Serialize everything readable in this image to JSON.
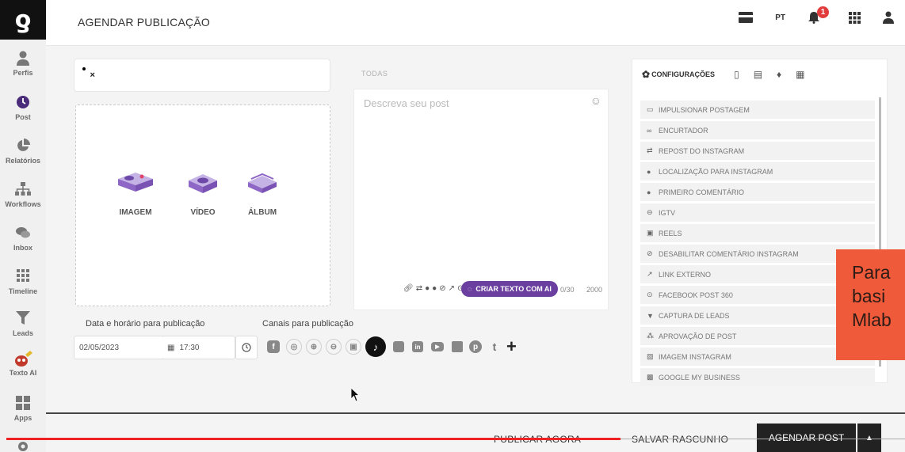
{
  "app": {
    "logo": "ƍ"
  },
  "header": {
    "title": "AGENDAR PUBLICAÇÃO",
    "lang": "PT",
    "notifications": "1"
  },
  "sidebar": {
    "items": [
      {
        "label": "Perfis",
        "icon": "user-icon"
      },
      {
        "label": "Post",
        "icon": "clock-icon"
      },
      {
        "label": "Relatórios",
        "icon": "pie-chart-icon"
      },
      {
        "label": "Workflows",
        "icon": "sitemap-icon"
      },
      {
        "label": "Inbox",
        "icon": "chat-icon"
      },
      {
        "label": "Timeline",
        "icon": "grid-icon"
      },
      {
        "label": "Leads",
        "icon": "filter-icon"
      },
      {
        "label": "Texto AI",
        "icon": "robot-icon"
      },
      {
        "label": "Apps",
        "icon": "apps-icon"
      }
    ]
  },
  "profiles": {
    "remove": "×"
  },
  "media": {
    "options": [
      {
        "label": "IMAGEM",
        "icon": "image-icon"
      },
      {
        "label": "VÍDEO",
        "icon": "video-icon"
      },
      {
        "label": "ÁLBUM",
        "icon": "album-icon"
      }
    ]
  },
  "schedule": {
    "label": "Data e horário para publicação",
    "date": "02/05/2023",
    "time": "17:30"
  },
  "channels": {
    "label": "Canais para publicação",
    "networks": [
      "facebook",
      "instagram",
      "threads",
      "linkedin",
      "stories",
      "tiktok",
      "twitter",
      "linkedin-page",
      "youtube",
      "google",
      "pinterest",
      "tumblr"
    ],
    "tumblr_letter": "t",
    "add": "+"
  },
  "post": {
    "tab": "TODAS",
    "placeholder": "Descreva seu post",
    "ai_button": "CRIAR TEXTO COM AI",
    "counter_chars": "0/30",
    "counter_max": "2000"
  },
  "settings": {
    "active_tab": "CONFIGURAÇÕES",
    "items": [
      {
        "label": "IMPULSIONAR POSTAGEM",
        "icon": "boost-icon"
      },
      {
        "label": "ENCURTADOR",
        "icon": "link-icon"
      },
      {
        "label": "REPOST DO INSTAGRAM",
        "icon": "repost-icon"
      },
      {
        "label": "LOCALIZAÇÃO PARA INSTAGRAM",
        "icon": "location-icon"
      },
      {
        "label": "PRIMEIRO COMENTÁRIO",
        "icon": "comment-icon"
      },
      {
        "label": "IGTV",
        "icon": "tv-icon"
      },
      {
        "label": "REELS",
        "icon": "reels-icon"
      },
      {
        "label": "DESABILITAR COMENTÁRIO INSTAGRAM",
        "icon": "ban-icon"
      },
      {
        "label": "LINK EXTERNO",
        "icon": "external-link-icon"
      },
      {
        "label": "FACEBOOK POST 360",
        "icon": "360-icon"
      },
      {
        "label": "CAPTURA DE LEADS",
        "icon": "filter-icon"
      },
      {
        "label": "APROVAÇÃO DE POST",
        "icon": "approval-icon"
      },
      {
        "label": "IMAGEM INSTAGRAM",
        "icon": "image-icon"
      },
      {
        "label": "GOOGLE MY BUSINESS",
        "icon": "google-business-icon"
      }
    ]
  },
  "promo": {
    "line1": "Para",
    "line2": "basi",
    "line3": "Mlab"
  },
  "footer": {
    "publish_now": "PUBLICAR AGORA",
    "save_draft": "SALVAR RASCUNHO",
    "schedule": "AGENDAR POST",
    "more": "▲"
  },
  "colors": {
    "accent": "#6b3fa0",
    "promo": "#ee5a3a",
    "progress": "#e22222",
    "tiktok": "#111111"
  }
}
